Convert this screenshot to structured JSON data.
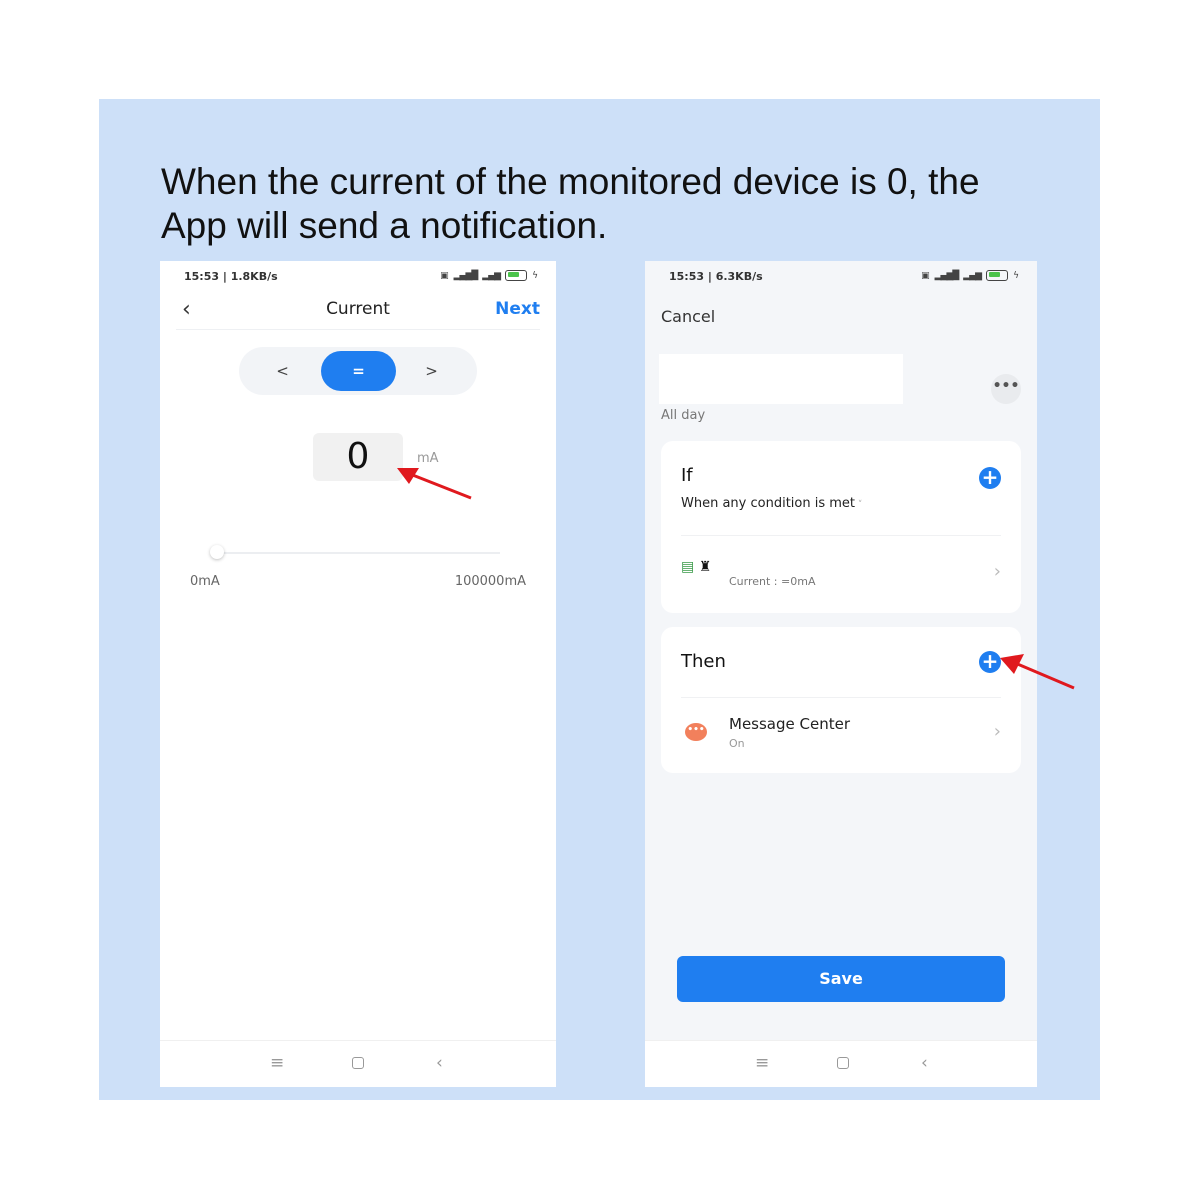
{
  "caption": "When the current of the monitored device is 0, the App will send a notification.",
  "colors": {
    "accent": "#1f7ef0",
    "background_panel": "#cde0f8",
    "arrow": "#e0191e",
    "message_icon": "#f2805c"
  },
  "left_screen": {
    "status": {
      "time_speed": "15:53 | 1.8KB/s",
      "icons": [
        "hd-icon",
        "4g-signal-icon",
        "signal-icon",
        "battery-icon",
        "charging-icon"
      ]
    },
    "header": {
      "back_icon": "chevron-left-icon",
      "title": "Current",
      "next_label": "Next"
    },
    "comparator": {
      "options": [
        "<",
        "=",
        ">"
      ],
      "selected": "="
    },
    "value": {
      "number": "0",
      "unit": "mA"
    },
    "slider": {
      "min_label": "0mA",
      "max_label": "100000mA",
      "value_fraction": 0
    },
    "navbar": {
      "menu": "≡",
      "home": "▢",
      "back": "‹"
    }
  },
  "right_screen": {
    "status": {
      "time_speed": "15:53 | 6.3KB/s",
      "icons": [
        "hd-icon",
        "4g-signal-icon",
        "signal-icon",
        "battery-icon",
        "charging-icon"
      ]
    },
    "cancel_label": "Cancel",
    "name_value": "",
    "more_label": "•••",
    "schedule_label": "All day",
    "if_card": {
      "title": "If",
      "condition_mode": "When any condition is met",
      "conditions": [
        {
          "device_icon": "device-icon",
          "text": "Current : =0mA"
        }
      ]
    },
    "then_card": {
      "title": "Then",
      "actions": [
        {
          "icon": "message-center-icon",
          "title": "Message Center",
          "subtitle": "On"
        }
      ]
    },
    "save_label": "Save",
    "navbar": {
      "menu": "≡",
      "home": "▢",
      "back": "‹"
    }
  }
}
